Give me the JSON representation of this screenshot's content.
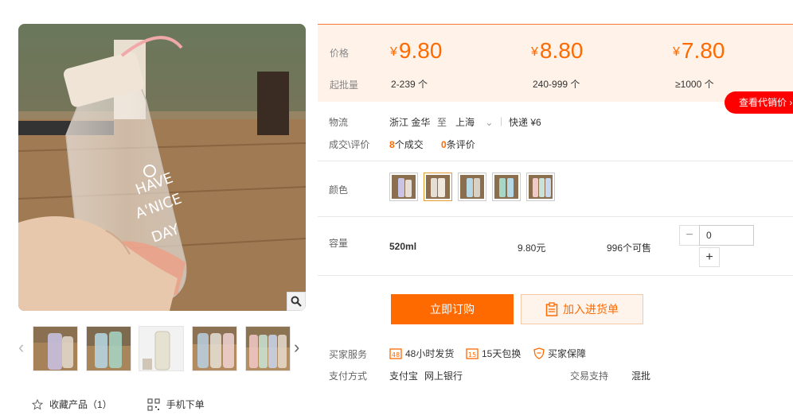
{
  "colors": {
    "accent": "#ff6a00",
    "price_bg": "#fff2e8",
    "agent_red": "#ff0000"
  },
  "gallery": {
    "main_image_icon": "water-bottle-image",
    "zoom_icon": "magnifier-icon",
    "prev_icon": "chevron-left-icon",
    "next_icon": "chevron-right-icon",
    "thumbnail_count": 5
  },
  "bottom_links": {
    "favorite": "收藏产品（1）",
    "mobile_order": "手机下单"
  },
  "price": {
    "price_label": "价格",
    "moq_label": "起批量",
    "currency": "¥",
    "tiers": [
      {
        "price": "9.80",
        "range": "2-239 个"
      },
      {
        "price": "8.80",
        "range": "240-999 个"
      },
      {
        "price": "7.80",
        "range": "≥1000 个"
      }
    ],
    "agent_button": "查看代销价"
  },
  "logistics": {
    "label": "物流",
    "from": "浙江 金华",
    "to_word": "至",
    "to": "上海",
    "shipping": "快递 ¥6"
  },
  "deals": {
    "label": "成交\\评价",
    "deal_count": "8",
    "deal_text": "个成交",
    "review_count": "0",
    "review_text": "条评价"
  },
  "color": {
    "label": "颜色",
    "swatch_count": 5
  },
  "capacity": {
    "label": "容量",
    "spec": "520ml",
    "price": "9.80元",
    "stock": "996个可售",
    "quantity": "0",
    "minus": "−",
    "plus": "+"
  },
  "actions": {
    "buy_now": "立即订购",
    "add_to_list": "加入进货单"
  },
  "services": {
    "label": "买家服务",
    "items": [
      "48小时发货",
      "15天包换",
      "买家保障"
    ]
  },
  "payment": {
    "label": "支付方式",
    "methods": [
      "支付宝",
      "网上银行"
    ],
    "trade_label": "交易支持",
    "trade_value": "混批"
  }
}
